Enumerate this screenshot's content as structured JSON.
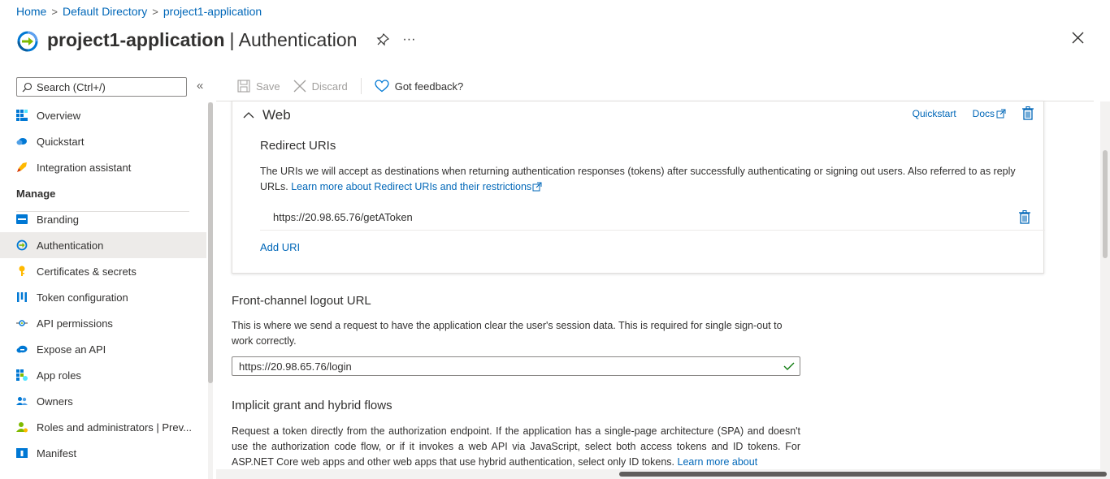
{
  "breadcrumb": {
    "home": "Home",
    "directory": "Default Directory",
    "app": "project1-application",
    "sep": ">"
  },
  "header": {
    "title": "project1-application",
    "subtitle": "| Authentication",
    "more": "···"
  },
  "sidebar": {
    "search_placeholder": "Search (Ctrl+/)",
    "collapse": "«",
    "items_top": [
      {
        "label": "Overview",
        "icon": "overview-grid-icon"
      },
      {
        "label": "Quickstart",
        "icon": "quickstart-cloud-icon"
      },
      {
        "label": "Integration assistant",
        "icon": "rocket-icon"
      }
    ],
    "manage_heading": "Manage",
    "items_manage": [
      {
        "label": "Branding",
        "icon": "branding-icon"
      },
      {
        "label": "Authentication",
        "icon": "authentication-icon",
        "active": true
      },
      {
        "label": "Certificates & secrets",
        "icon": "key-icon"
      },
      {
        "label": "Token configuration",
        "icon": "token-bars-icon"
      },
      {
        "label": "API permissions",
        "icon": "api-permissions-icon"
      },
      {
        "label": "Expose an API",
        "icon": "cloud-api-icon"
      },
      {
        "label": "App roles",
        "icon": "app-roles-icon"
      },
      {
        "label": "Owners",
        "icon": "owners-icon"
      },
      {
        "label": "Roles and administrators | Prev...",
        "icon": "roles-admin-icon"
      },
      {
        "label": "Manifest",
        "icon": "manifest-icon"
      }
    ]
  },
  "toolbar": {
    "save": "Save",
    "discard": "Discard",
    "feedback": "Got feedback?"
  },
  "web": {
    "title": "Web",
    "quickstart": "Quickstart",
    "docs": "Docs",
    "redirect_title": "Redirect URIs",
    "redirect_desc": "The URIs we will accept as destinations when returning authentication responses (tokens) after successfully authenticating or signing out users. Also referred to as reply URLs.",
    "redirect_link": "Learn more about Redirect URIs and their restrictions",
    "uris": [
      "https://20.98.65.76/getAToken"
    ],
    "add_uri": "Add URI"
  },
  "logout": {
    "title": "Front-channel logout URL",
    "desc": "This is where we send a request to have the application clear the user's session data. This is required for single sign-out to work correctly.",
    "value": "https://20.98.65.76/login"
  },
  "implicit": {
    "title": "Implicit grant and hybrid flows",
    "desc": "Request a token directly from the authorization endpoint. If the application has a single-page architecture (SPA) and doesn't use the authorization code flow, or if it invokes a web API via JavaScript, select both access tokens and ID tokens. For ASP.NET Core web apps and other web apps that use hybrid authentication, select only ID tokens.",
    "link": "Learn more about"
  },
  "colors": {
    "accent": "#0067b8",
    "success": "#107c10",
    "active_bg": "#edebe9"
  }
}
